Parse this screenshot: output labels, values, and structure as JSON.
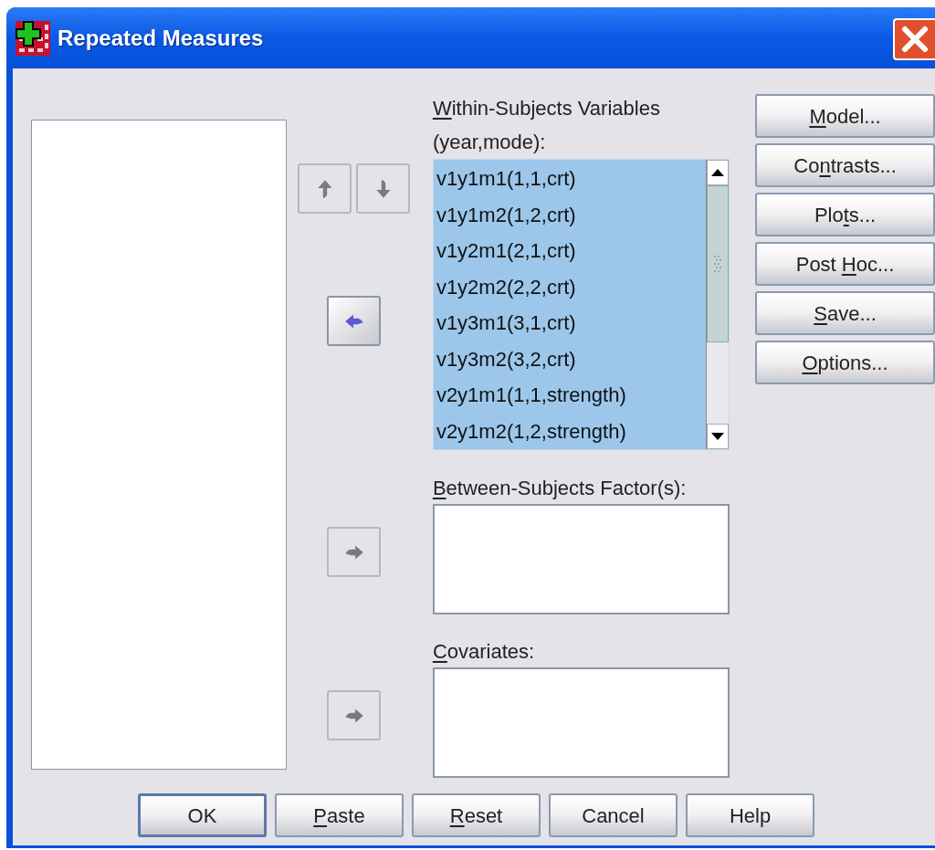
{
  "window": {
    "title": "Repeated Measures"
  },
  "reorder_buttons": [
    {
      "kind": "up",
      "disabled": true
    },
    {
      "kind": "down",
      "disabled": true
    }
  ],
  "within_subjects": {
    "label": {
      "key": "W",
      "after": "ithin-Subjects Variables"
    },
    "sublabel": "(year,mode):",
    "move_button": {
      "disabled": false
    },
    "items": [
      {
        "text": "v1y1m1(1,1,crt)",
        "selected": true
      },
      {
        "text": "v1y1m2(1,2,crt)",
        "selected": true
      },
      {
        "text": "v1y2m1(2,1,crt)",
        "selected": true
      },
      {
        "text": "v1y2m2(2,2,crt)",
        "selected": true
      },
      {
        "text": "v1y3m1(3,1,crt)",
        "selected": true
      },
      {
        "text": "v1y3m2(3,2,crt)",
        "selected": true
      },
      {
        "text": "v2y1m1(1,1,strength)",
        "selected": true
      },
      {
        "text": "v2y1m2(1,2,strength)",
        "selected": true
      }
    ]
  },
  "between_subjects": {
    "label": {
      "key": "B",
      "after": "etween-Subjects Factor(s):"
    },
    "move_button": {
      "disabled": true
    }
  },
  "covariates": {
    "label": {
      "key": "C",
      "after": "ovariates:"
    },
    "move_button": {
      "disabled": true
    }
  },
  "side_buttons": [
    {
      "key": "M",
      "after": "odel..."
    },
    {
      "before": "Co",
      "key": "n",
      "after": "trasts..."
    },
    {
      "before": "Plo",
      "key": "t",
      "after": "s..."
    },
    {
      "before": "Post ",
      "key": "H",
      "after": "oc..."
    },
    {
      "key": "S",
      "after": "ave..."
    },
    {
      "key": "O",
      "after": "ptions..."
    }
  ],
  "bottom_buttons": [
    {
      "before": "OK",
      "default": true
    },
    {
      "key": "P",
      "after": "aste",
      "default": false
    },
    {
      "key": "R",
      "after": "eset",
      "default": false
    },
    {
      "before": "Cancel",
      "default": false
    },
    {
      "before": "Help",
      "default": false
    }
  ]
}
